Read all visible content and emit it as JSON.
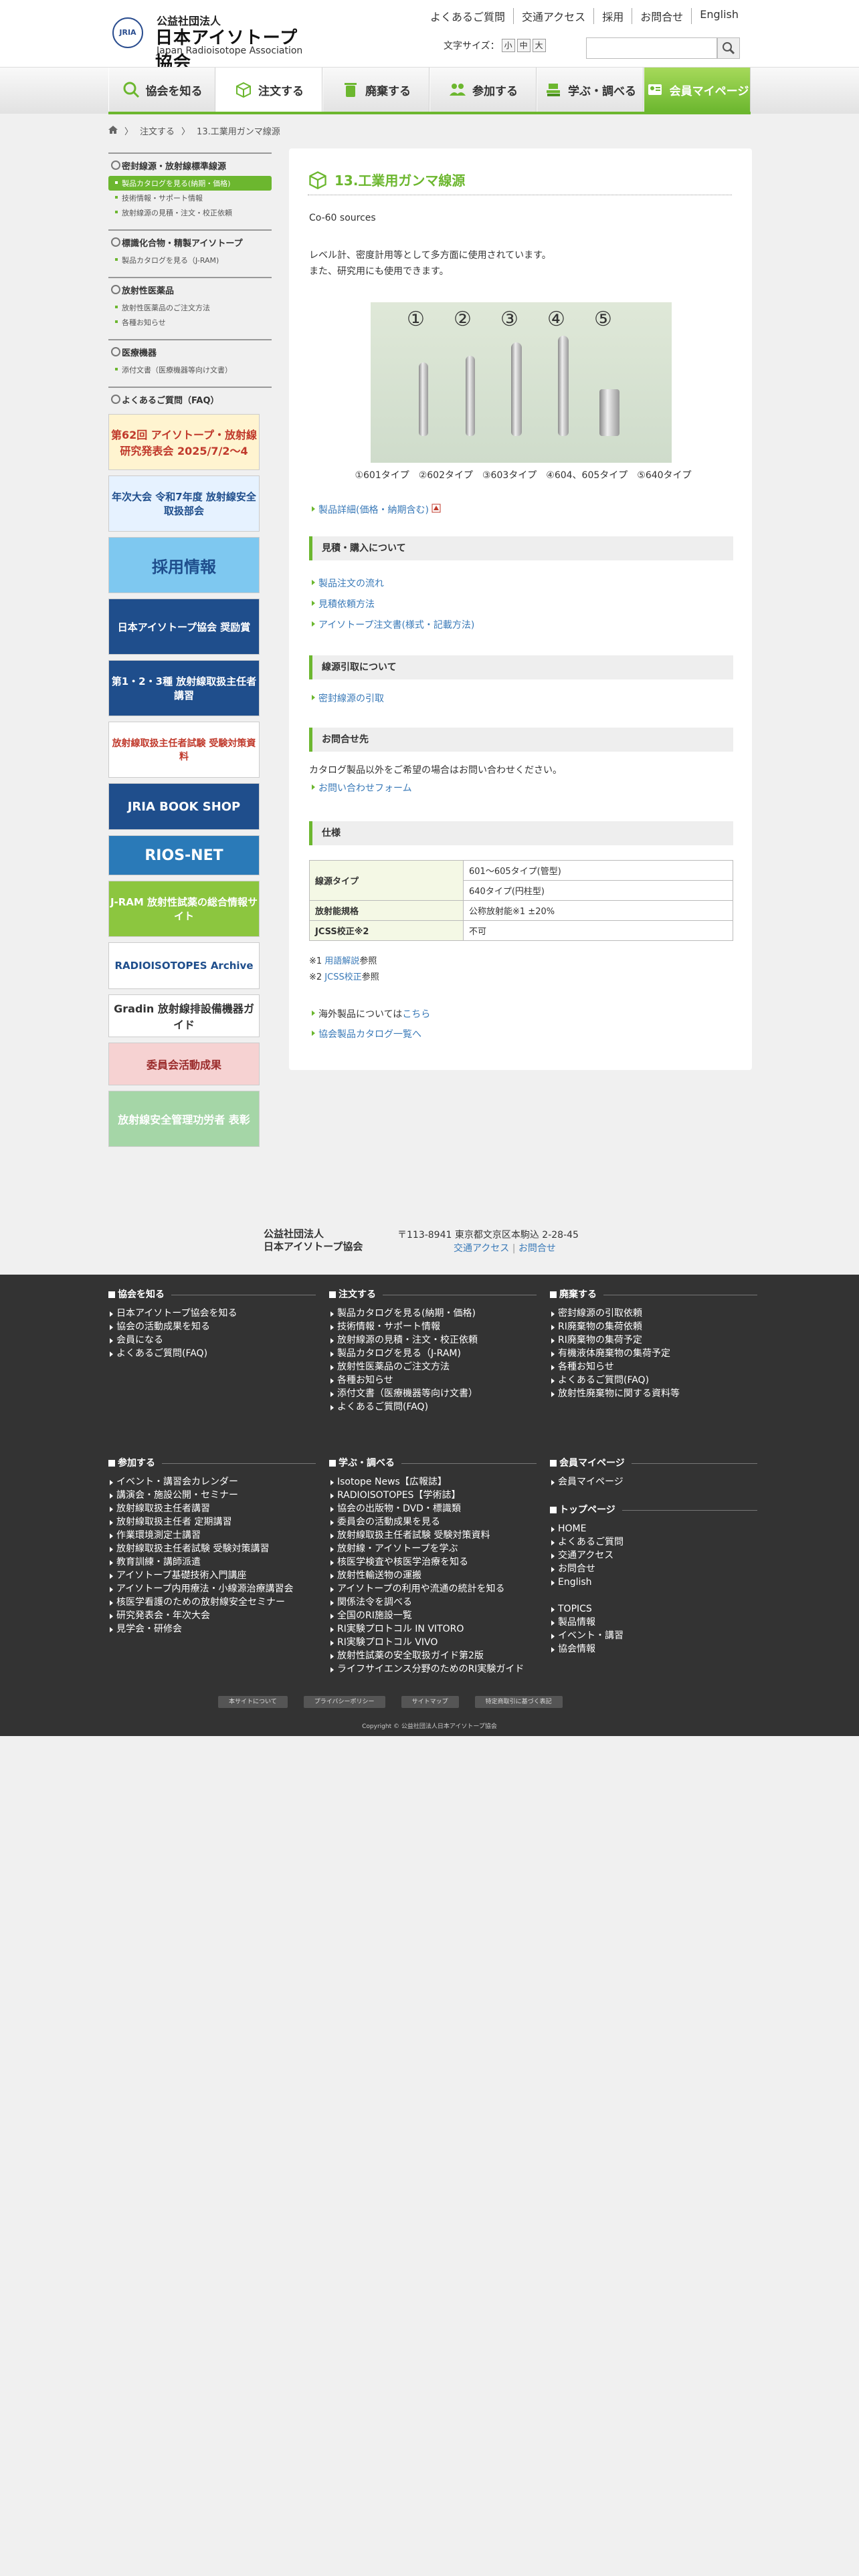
{
  "header": {
    "logo": {
      "line1": "公益社団法人",
      "line2": "日本アイソトープ協会",
      "line3": "Japan Radioisotope Association",
      "emblem": "JRIA"
    },
    "top_links": [
      "よくあるご質問",
      "交通アクセス",
      "採用",
      "お問合せ",
      "English"
    ],
    "font_size": {
      "label": "文字サイズ：",
      "options": [
        "小",
        "中",
        "大"
      ]
    },
    "search": {
      "placeholder": ""
    }
  },
  "nav": {
    "items": [
      {
        "label": "協会を知る",
        "icon": "search-icon"
      },
      {
        "label": "注文する",
        "icon": "box-icon"
      },
      {
        "label": "廃棄する",
        "icon": "trash-icon"
      },
      {
        "label": "参加する",
        "icon": "people-icon"
      },
      {
        "label": "学ぶ・調べる",
        "icon": "book-icon"
      },
      {
        "label": "会員マイページ",
        "icon": "member-icon"
      }
    ],
    "accent": "#6cb72f"
  },
  "breadcrumb": [
    "注文する",
    "13.工業用ガンマ線源"
  ],
  "sidebar": {
    "sections": [
      {
        "title": "密封線源・放射線標準線源",
        "items": [
          "製品カタログを見る(納期・価格)",
          "技術情報・サポート情報",
          "放射線源の見積・注文・校正依頼"
        ],
        "active": 0
      },
      {
        "title": "標識化合物・精製アイソトープ",
        "items": [
          "製品カタログを見る（J-RAM)"
        ]
      },
      {
        "title": "放射性医薬品",
        "items": [
          "放射性医薬品のご注文方法",
          "各種お知らせ"
        ]
      },
      {
        "title": "医療機器",
        "items": [
          "添付文書（医療機器等向け文書）"
        ]
      },
      {
        "title": "よくあるご質問（FAQ）",
        "items": []
      }
    ],
    "banners": [
      {
        "text": "第62回 アイソトープ・放射線 研究発表会 2025/7/2〜4",
        "bg": "#fff4d0",
        "fg": "#c0392b"
      },
      {
        "text": "年次大会 令和7年度 放射線安全取扱部会",
        "bg": "#e6f2ff",
        "fg": "#1f4e8c"
      },
      {
        "text": "採用情報",
        "bg": "#7ec8f0",
        "fg": "#1f4e8c"
      },
      {
        "text": "日本アイソトープ協会 奨励賞",
        "bg": "#1f4e8c",
        "fg": "#ffffff"
      },
      {
        "text": "第1・2・3種 放射線取扱主任者講習",
        "bg": "#1f4e8c",
        "fg": "#ffffff"
      },
      {
        "text": "放射線取扱主任者試験 受験対策資料",
        "bg": "#ffffff",
        "fg": "#c0392b"
      },
      {
        "text": "JRIA BOOK SHOP",
        "bg": "#1f4e8c",
        "fg": "#ffffff"
      },
      {
        "text": "RIOS-NET",
        "bg": "#2a7ab8",
        "fg": "#ffffff"
      },
      {
        "text": "J-RAM 放射性試薬の総合情報サイト",
        "bg": "#8cc63f",
        "fg": "#ffffff"
      },
      {
        "text": "RADIOISOTOPES Archive",
        "bg": "#ffffff",
        "fg": "#1f4e8c"
      },
      {
        "text": "Gradin 放射線排設備機器ガイド",
        "bg": "#ffffff",
        "fg": "#333333"
      },
      {
        "text": "委員会活動成果",
        "bg": "#f6d2d2",
        "fg": "#9b2c2c"
      },
      {
        "text": "放射線安全管理功労者 表彰",
        "bg": "#a5d6a7",
        "fg": "#ffffff"
      }
    ]
  },
  "main": {
    "title": "13.工業用ガンマ線源",
    "subtitle": "Co-60 sources",
    "desc1": "レベル計、密度計用等として多方面に使用されています。",
    "desc2": "また、研究用にも使用できます。",
    "photo_numbers": [
      "①",
      "②",
      "③",
      "④",
      "⑤"
    ],
    "caption": "①601タイプ　②602タイプ　③603タイプ　④604、605タイプ　⑤640タイプ",
    "detail_link": "製品詳細(価格・納期含む)",
    "sections": {
      "purchase": {
        "title": "見積・購入について",
        "links": [
          "製品注文の流れ",
          "見積依頼方法",
          "アイソトープ注文書(様式・記載方法)"
        ]
      },
      "disposal": {
        "title": "線源引取について",
        "links": [
          "密封線源の引取"
        ]
      },
      "contact": {
        "title": "お問合せ先",
        "text": "カタログ製品以外をご希望の場合はお問い合わせください。",
        "links": [
          "お問い合わせフォーム"
        ]
      },
      "spec": {
        "title": "仕様"
      }
    },
    "spec_table": [
      {
        "label": "線源タイプ",
        "values": [
          "601〜605タイプ(管型)",
          "640タイプ(円柱型)"
        ]
      },
      {
        "label": "放射能規格",
        "values": [
          "公称放射能※1 ±20%"
        ]
      },
      {
        "label": "JCSS校正※2",
        "values": [
          "不可"
        ]
      }
    ],
    "notes": [
      {
        "prefix": "※1 ",
        "link": "用語解説",
        "suffix": "参照"
      },
      {
        "prefix": "※2 ",
        "link": "JCSS校正",
        "suffix": "参照"
      }
    ],
    "overseas": {
      "prefix": "海外製品については",
      "link": "こちら"
    },
    "catalog_link": "協会製品カタログ一覧へ"
  },
  "footer_address": {
    "org1": "公益社団法人",
    "org2": "日本アイソトープ協会",
    "address": "〒113-8941 東京都文京区本駒込 2-28-45",
    "links": [
      "交通アクセス",
      "お問合せ"
    ]
  },
  "footer": {
    "columns": [
      {
        "title": "協会を知る",
        "items": [
          "日本アイソトープ協会を知る",
          "協会の活動成果を知る",
          "会員になる",
          "よくあるご質問(FAQ)"
        ]
      },
      {
        "title": "注文する",
        "items": [
          "製品カタログを見る(納期・価格)",
          "技術情報・サポート情報",
          "放射線源の見積・注文・校正依頼",
          "製品カタログを見る（J-RAM)",
          "放射性医薬品のご注文方法",
          "各種お知らせ",
          "添付文書（医療機器等向け文書）",
          "よくあるご質問(FAQ)"
        ]
      },
      {
        "title": "廃棄する",
        "items": [
          "密封線源の引取依頼",
          "RI廃棄物の集荷依頼",
          "RI廃棄物の集荷予定",
          "有機液体廃棄物の集荷予定",
          "各種お知らせ",
          "よくあるご質問(FAQ)",
          "放射性廃棄物に関する資料等"
        ]
      },
      {
        "title": "参加する",
        "items": [
          "イベント・講習会カレンダー",
          "講演会・施設公開・セミナー",
          "放射線取扱主任者講習",
          "放射線取扱主任者 定期講習",
          "作業環境測定士講習",
          "放射線取扱主任者試験 受験対策講習",
          "教育訓練・講師派遣",
          "アイソトープ基礎技術入門講座",
          "アイソトープ内用療法・小線源治療講習会",
          "核医学看護のための放射線安全セミナー",
          "研究発表会・年次大会",
          "見学会・研修会"
        ]
      },
      {
        "title": "学ぶ・調べる",
        "items": [
          "Isotope News【広報誌】",
          "RADIOISOTOPES【学術誌】",
          "協会の出版物・DVD・標識類",
          "委員会の活動成果を見る",
          "放射線取扱主任者試験 受験対策資料",
          "放射線・アイソトープを学ぶ",
          "核医学検査や核医学治療を知る",
          "放射性輸送物の運搬",
          "アイソトープの利用や流通の統計を知る",
          "関係法令を調べる",
          "全国のRI施設一覧",
          "RI実験プロトコル IN VITORO",
          "RI実験プロトコル VIVO",
          "放射性試薬の安全取扱ガイド第2版",
          "ライフサイエンス分野のためのRI実験ガイド"
        ]
      },
      {
        "title": "会員マイページ",
        "items": [
          "会員マイページ"
        ]
      },
      {
        "title": "トップページ",
        "items": [
          "HOME",
          "よくあるご質問",
          "交通アクセス",
          "お問合せ",
          "English"
        ]
      },
      {
        "title": "",
        "items": [
          "TOPICS",
          "製品情報",
          "イベント・講習",
          "協会情報"
        ]
      }
    ],
    "bottom_links": [
      "本サイトについて",
      "プライバシーポリシー",
      "サイトマップ",
      "特定商取引に基づく表記"
    ],
    "copyright": "Copyright © 公益社団法人日本アイソトープ協会"
  }
}
